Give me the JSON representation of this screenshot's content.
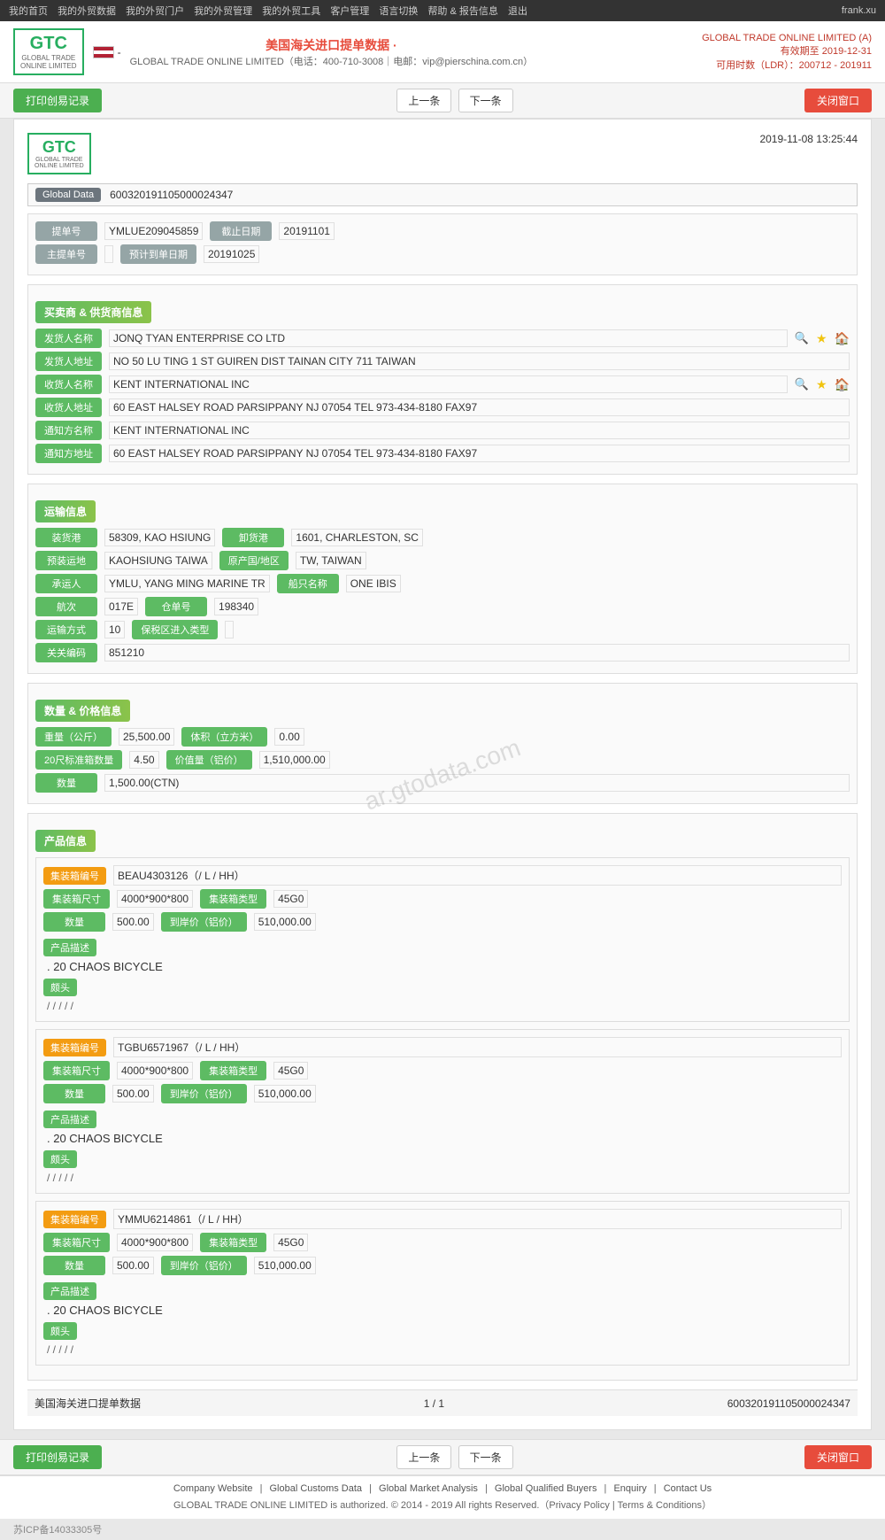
{
  "topnav": {
    "links": [
      "我的首页",
      "我的外贸数据",
      "我的外贸门户",
      "我的外贸管理",
      "我的外贸工具",
      "客户管理",
      "语言切换",
      "帮助 & 报告信息",
      "退出"
    ],
    "user": "frank.xu"
  },
  "header": {
    "logo": "GTC",
    "logo_sub": "GLOBAL TRADE ONLINE LIMITED",
    "title": "美国海关进口提单数据 ·",
    "subtitle": "GLOBAL TRADE ONLINE LIMITED（电话：400-710-3008｜电邮：vip@pierschina.com.cn）",
    "company": "GLOBAL TRADE ONLINE LIMITED (A)",
    "valid_until": "有效期至 2019-12-31",
    "ldr": "可用时数（LDR）：200712 - 201911"
  },
  "toolbar": {
    "print_btn": "打印创易记录",
    "prev_btn": "上一条",
    "next_btn": "下一条",
    "close_btn": "关闭窗口"
  },
  "document": {
    "timestamp": "2019-11-08 13:25:44",
    "global_data_label": "Global Data",
    "global_data_value": "600320191105000024347",
    "bill_no_label": "提单号",
    "bill_no_value": "YMLUE209045859",
    "cut_date_label": "截止日期",
    "cut_date_value": "20191101",
    "master_bill_label": "主提单号",
    "master_bill_value": "",
    "est_date_label": "预计到单日期",
    "est_date_value": "20191025"
  },
  "shipper_section": {
    "title": "买卖商 & 供货商信息",
    "shipper_name_label": "发货人名称",
    "shipper_name_value": "JONQ TYAN ENTERPRISE CO LTD",
    "shipper_addr_label": "发货人地址",
    "shipper_addr_value": "NO 50 LU TING 1 ST GUIREN DIST TAINAN CITY 711 TAIWAN",
    "consignee_name_label": "收货人名称",
    "consignee_name_value": "KENT INTERNATIONAL INC",
    "consignee_addr_label": "收货人地址",
    "consignee_addr_value": "60 EAST HALSEY ROAD PARSIPPANY NJ 07054 TEL 973-434-8180 FAX97",
    "notify_name_label": "通知方名称",
    "notify_name_value": "KENT INTERNATIONAL INC",
    "notify_addr_label": "通知方地址",
    "notify_addr_value": "60 EAST HALSEY ROAD PARSIPPANY NJ 07054 TEL 973-434-8180 FAX97"
  },
  "transport_section": {
    "title": "运输信息",
    "load_port_label": "装货港",
    "load_port_value": "58309, KAO HSIUNG",
    "unload_port_label": "卸货港",
    "unload_port_value": "1601, CHARLESTON, SC",
    "dest_label": "预装运地",
    "dest_value": "KAOHSIUNG TAIWA",
    "origin_label": "原产国/地区",
    "origin_value": "TW, TAIWAN",
    "carrier_label": "承运人",
    "carrier_value": "YMLU, YANG MING MARINE TR",
    "vessel_label": "船只名称",
    "vessel_value": "ONE IBIS",
    "voyage_label": "航次",
    "voyage_value": "017E",
    "bill_lading_label": "仓单号",
    "bill_lading_value": "198340",
    "transport_label": "运输方式",
    "transport_value": "10",
    "bonded_label": "保税区进入类型",
    "bonded_value": "",
    "customs_label": "关关编码",
    "customs_value": "851210"
  },
  "quantity_section": {
    "title": "数量 & 价格信息",
    "weight_label": "重量（公斤）",
    "weight_value": "25,500.00",
    "volume_label": "体积（立方米）",
    "volume_value": "0.00",
    "container20_label": "20尺标准箱数量",
    "container20_value": "4.50",
    "value_label": "价值量（铝价）",
    "value_value": "1,510,000.00",
    "quantity_label": "数量",
    "quantity_value": "1,500.00(CTN)"
  },
  "products_section": {
    "title": "产品信息",
    "products": [
      {
        "container_no_label": "集装箱编号",
        "container_no_value": "BEAU4303126（/ L / HH）",
        "size_label": "集装箱尺寸",
        "size_value": "4000*900*800",
        "type_label": "集装箱类型",
        "type_value": "45G0",
        "qty_label": "数量",
        "qty_value": "500.00",
        "price_label": "到岸价（铝价）",
        "price_value": "510,000.00",
        "desc_label": "产品描述",
        "desc_value": ". 20 CHAOS BICYCLE",
        "method_label": "颇头",
        "method_value": "/ / / / /"
      },
      {
        "container_no_label": "集装箱编号",
        "container_no_value": "TGBU6571967（/ L / HH）",
        "size_label": "集装箱尺寸",
        "size_value": "4000*900*800",
        "type_label": "集装箱类型",
        "type_value": "45G0",
        "qty_label": "数量",
        "qty_value": "500.00",
        "price_label": "到岸价（铝价）",
        "price_value": "510,000.00",
        "desc_label": "产品描述",
        "desc_value": ". 20 CHAOS BICYCLE",
        "method_label": "颇头",
        "method_value": "/ / / / /"
      },
      {
        "container_no_label": "集装箱编号",
        "container_no_value": "YMMU6214861（/ L / HH）",
        "size_label": "集装箱尺寸",
        "size_value": "4000*900*800",
        "type_label": "集装箱类型",
        "type_value": "45G0",
        "qty_label": "数量",
        "qty_value": "500.00",
        "price_label": "到岸价（铝价）",
        "price_value": "510,000.00",
        "desc_label": "产品描述",
        "desc_value": ". 20 CHAOS BICYCLE",
        "method_label": "颇头",
        "method_value": "/ / / / /"
      }
    ]
  },
  "doc_footer": {
    "left": "美国海关进口提单数据",
    "page": "1 / 1",
    "right": "600320191105000024347"
  },
  "footer": {
    "links": [
      "Company Website",
      "Global Customs Data",
      "Global Market Analysis",
      "Global Qualified Buyers",
      "Enquiry",
      "Contact Us"
    ],
    "copyright": "GLOBAL TRADE ONLINE LIMITED is authorized. © 2014 - 2019 All rights Reserved.（Privacy Policy | Terms & Conditions）",
    "icp": "苏ICP备14033305号"
  }
}
